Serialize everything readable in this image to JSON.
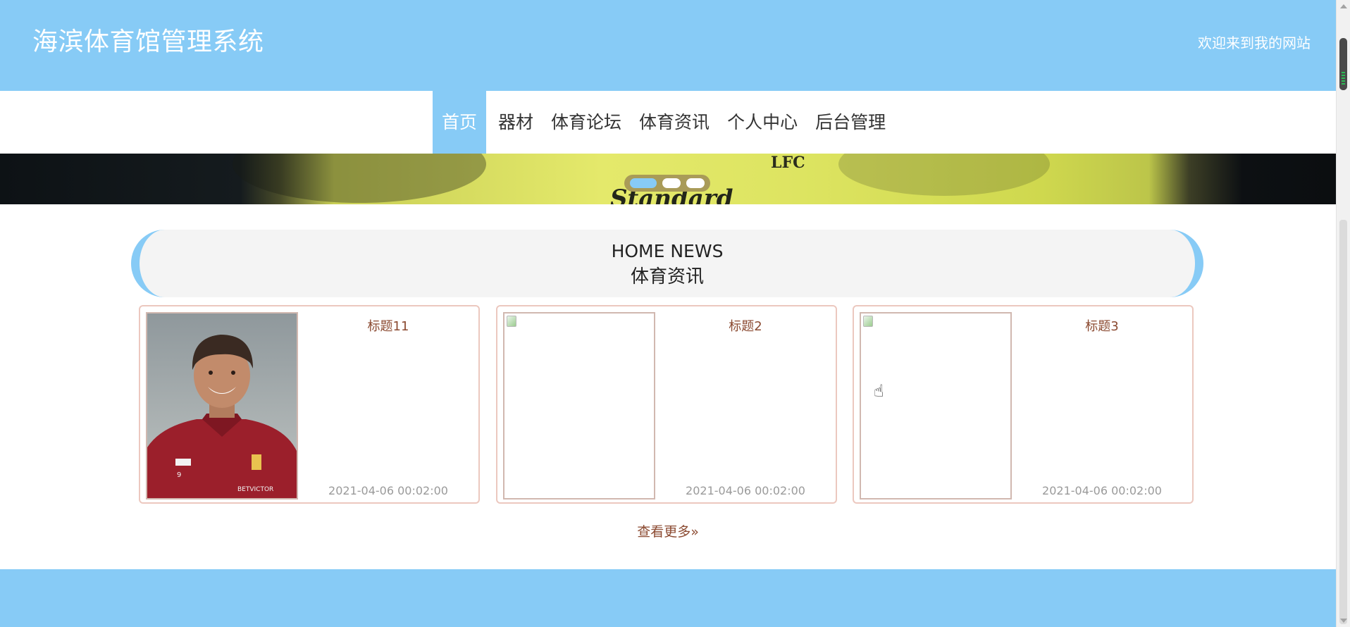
{
  "header": {
    "site_title": "海滨体育馆管理系统",
    "welcome": "欢迎来到我的网站"
  },
  "nav": {
    "items": [
      {
        "label": "首页",
        "active": true
      },
      {
        "label": "器材",
        "active": false
      },
      {
        "label": "体育论坛",
        "active": false
      },
      {
        "label": "体育资讯",
        "active": false
      },
      {
        "label": "个人中心",
        "active": false
      },
      {
        "label": "后台管理",
        "active": false
      }
    ]
  },
  "banner": {
    "slides": 3,
    "active_slide": 1,
    "logo_text": "LFC",
    "sponsor_text": "Standard"
  },
  "news": {
    "heading_en": "HOME NEWS",
    "heading_cn": "体育资讯",
    "cards": [
      {
        "title": "标题11",
        "time": "2021-04-06 00:02:00",
        "image": "player-photo"
      },
      {
        "title": "标题2",
        "time": "2021-04-06 00:02:00",
        "image": "broken-image"
      },
      {
        "title": "标题3",
        "time": "2021-04-06 00:02:00",
        "image": "broken-image"
      }
    ],
    "more_label": "查看更多»"
  },
  "colors": {
    "primary": "#87cbf6",
    "title_text": "#8b4a31",
    "card_border": "#ecc8bf",
    "section_bg": "#f4f4f4"
  }
}
